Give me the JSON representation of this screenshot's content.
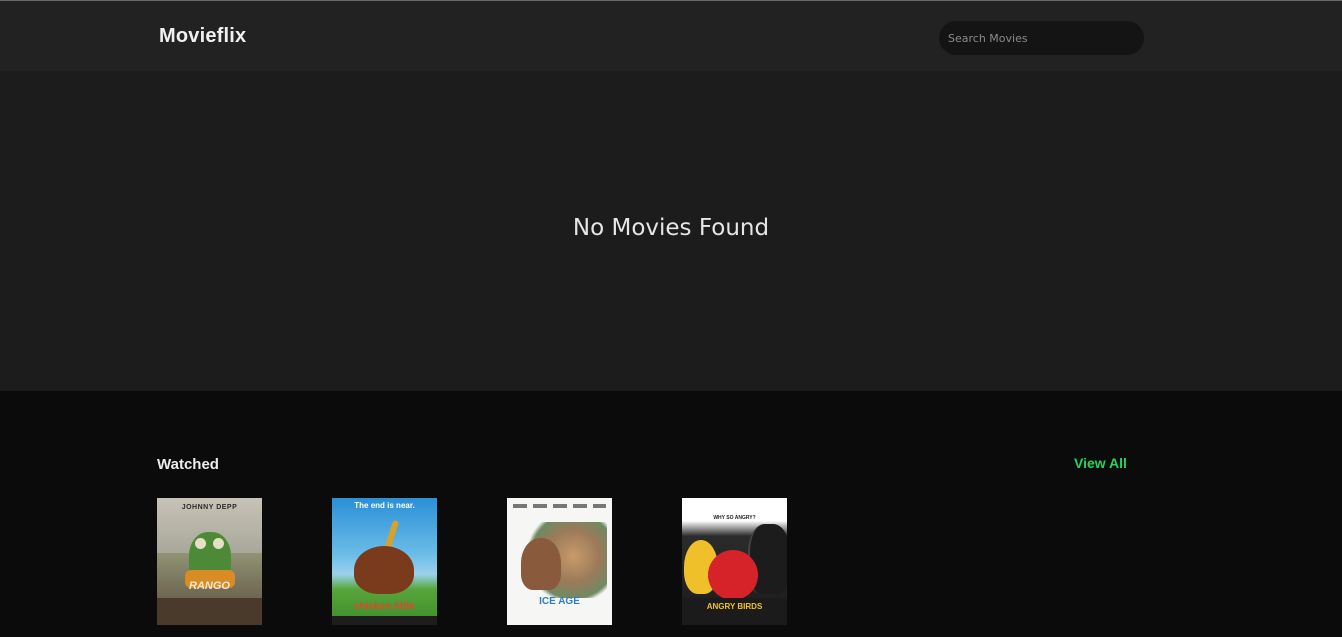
{
  "app": {
    "brand": "Movieflix"
  },
  "search": {
    "placeholder": "Search Movies",
    "value": ""
  },
  "hero": {
    "message": "No Movies Found"
  },
  "watched": {
    "title": "Watched",
    "view_all_label": "View All",
    "posters": [
      {
        "name": "Rango",
        "top_text": "JOHNNY DEPP",
        "title_text": "RANGO"
      },
      {
        "name": "Chicken Little",
        "top_text": "The end is near.",
        "title_text": "chicken little"
      },
      {
        "name": "Ice Age: Dawn of the Dinosaurs",
        "title_text": "ICE AGE"
      },
      {
        "name": "The Angry Birds Movie",
        "top_text": "WHY SO ANGRY?",
        "title_text": "ANGRY BIRDS"
      }
    ]
  },
  "colors": {
    "header_bg": "#222222",
    "hero_bg": "#1c1c1c",
    "page_bg": "#0b0b0b",
    "accent": "#1ed760",
    "text": "#ececec"
  }
}
